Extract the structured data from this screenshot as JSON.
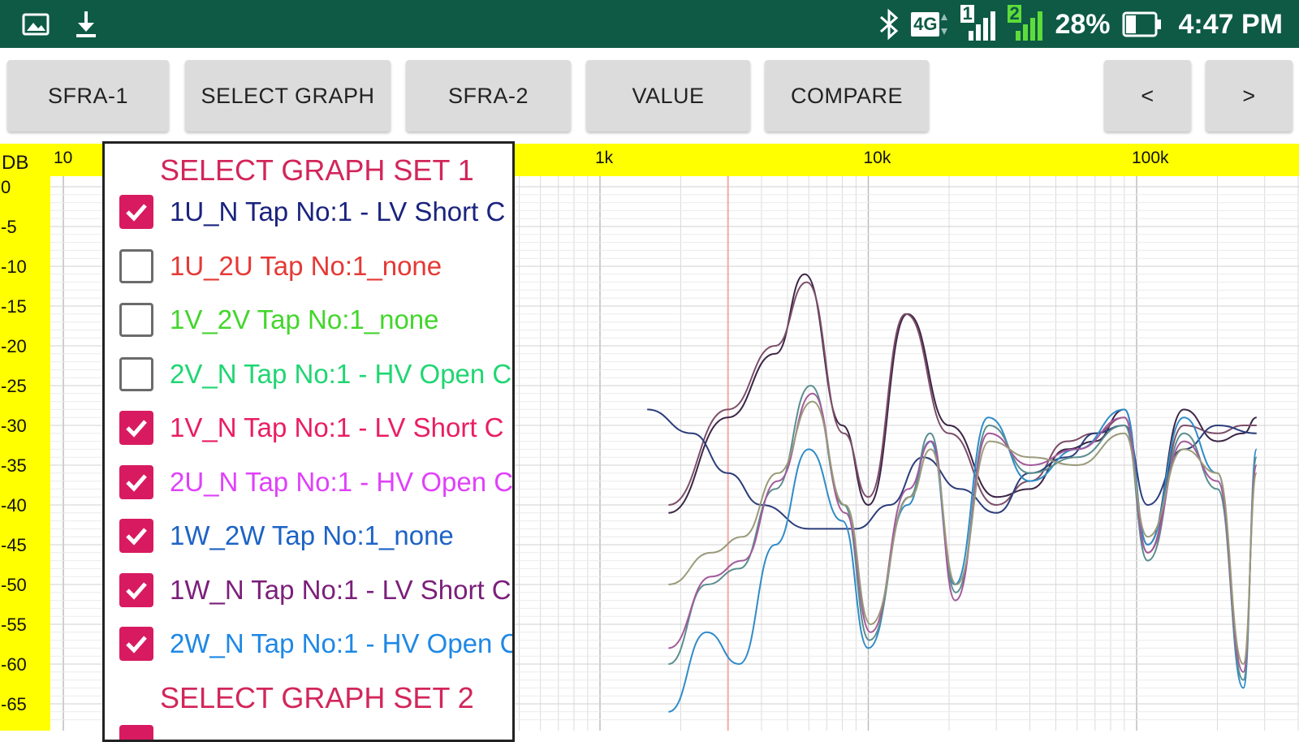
{
  "status_bar": {
    "network": "4G",
    "sim1": "1",
    "sim2": "2",
    "battery": "28%",
    "time": "4:47 PM",
    "icons": [
      "image-icon",
      "download-icon",
      "bluetooth-icon",
      "network-4g-icon",
      "signal-sim1-icon",
      "signal-sim2-icon",
      "battery-icon"
    ]
  },
  "toolbar": {
    "buttons": [
      {
        "label": "SFRA-1"
      },
      {
        "label": "SELECT GRAPH"
      },
      {
        "label": "SFRA-2"
      },
      {
        "label": "VALUE"
      },
      {
        "label": "COMPARE"
      },
      {
        "label": "<"
      },
      {
        "label": ">"
      }
    ]
  },
  "chart_data": {
    "type": "line",
    "title": "",
    "xlabel": "",
    "ylabel": "DB",
    "x_scale": "log",
    "x_ticks": [
      "10",
      "1k",
      "10k",
      "100k"
    ],
    "y_ticks": [
      "0",
      "-5",
      "-10",
      "-15",
      "-20",
      "-25",
      "-30",
      "-35",
      "-40",
      "-45",
      "-50",
      "-55",
      "-60",
      "-65"
    ],
    "ylim": [
      -67,
      2
    ],
    "grid": true,
    "axis_band_color": "#ffff00",
    "marker_x": 3000,
    "series": [
      {
        "color": "#3b2545",
        "points": [
          [
            1800,
            -41
          ],
          [
            3000,
            -29
          ],
          [
            4500,
            -21
          ],
          [
            5800,
            -11
          ],
          [
            8000,
            -30
          ],
          [
            10000,
            -40
          ],
          [
            14000,
            -16
          ],
          [
            20000,
            -30
          ],
          [
            30000,
            -39
          ],
          [
            40000,
            -38
          ],
          [
            55000,
            -33
          ],
          [
            70000,
            -32
          ],
          [
            90000,
            -28
          ],
          [
            110000,
            -45
          ],
          [
            150000,
            -28
          ],
          [
            200000,
            -32
          ],
          [
            250000,
            -31
          ],
          [
            280000,
            -29
          ]
        ]
      },
      {
        "color": "#7d4e68",
        "points": [
          [
            1800,
            -40
          ],
          [
            3000,
            -28
          ],
          [
            4500,
            -20
          ],
          [
            5900,
            -12
          ],
          [
            8100,
            -31
          ],
          [
            10000,
            -39
          ],
          [
            13800,
            -16
          ],
          [
            20000,
            -31
          ],
          [
            30000,
            -40
          ],
          [
            40000,
            -37
          ],
          [
            55000,
            -32
          ],
          [
            70000,
            -31
          ],
          [
            90000,
            -29
          ],
          [
            110000,
            -46
          ],
          [
            150000,
            -30
          ],
          [
            200000,
            -31
          ],
          [
            250000,
            -30
          ],
          [
            280000,
            -30
          ]
        ]
      },
      {
        "color": "#2b3d7a",
        "points": [
          [
            1500,
            -28
          ],
          [
            2200,
            -31
          ],
          [
            3000,
            -36
          ],
          [
            4000,
            -40
          ],
          [
            6000,
            -43
          ],
          [
            9000,
            -43
          ],
          [
            12000,
            -40
          ],
          [
            16000,
            -34
          ],
          [
            22000,
            -38
          ],
          [
            30000,
            -41
          ],
          [
            40000,
            -36
          ],
          [
            55000,
            -34
          ],
          [
            70000,
            -31
          ],
          [
            90000,
            -30
          ],
          [
            110000,
            -40
          ],
          [
            150000,
            -33
          ],
          [
            200000,
            -30
          ],
          [
            280000,
            -31
          ]
        ]
      },
      {
        "color": "#2f8cc8",
        "points": [
          [
            1800,
            -66
          ],
          [
            2500,
            -56
          ],
          [
            3300,
            -60
          ],
          [
            4500,
            -45
          ],
          [
            6000,
            -33
          ],
          [
            8000,
            -42
          ],
          [
            10000,
            -58
          ],
          [
            14000,
            -40
          ],
          [
            17000,
            -32
          ],
          [
            21000,
            -50
          ],
          [
            28000,
            -29
          ],
          [
            40000,
            -37
          ],
          [
            60000,
            -33
          ],
          [
            90000,
            -28
          ],
          [
            110000,
            -45
          ],
          [
            150000,
            -29
          ],
          [
            200000,
            -36
          ],
          [
            250000,
            -63
          ],
          [
            280000,
            -33
          ]
        ]
      },
      {
        "color": "#5a8e8f",
        "points": [
          [
            1800,
            -60
          ],
          [
            2500,
            -50
          ],
          [
            3300,
            -48
          ],
          [
            4500,
            -38
          ],
          [
            6100,
            -25
          ],
          [
            8100,
            -40
          ],
          [
            10100,
            -57
          ],
          [
            14200,
            -39
          ],
          [
            17000,
            -31
          ],
          [
            21200,
            -51
          ],
          [
            28200,
            -30
          ],
          [
            40000,
            -36
          ],
          [
            60000,
            -34
          ],
          [
            90000,
            -30
          ],
          [
            110000,
            -47
          ],
          [
            150000,
            -31
          ],
          [
            200000,
            -38
          ],
          [
            250000,
            -62
          ],
          [
            280000,
            -34
          ]
        ]
      },
      {
        "color": "#a35a9c",
        "points": [
          [
            1800,
            -58
          ],
          [
            2600,
            -49
          ],
          [
            3400,
            -47
          ],
          [
            4600,
            -37
          ],
          [
            6200,
            -26
          ],
          [
            8200,
            -41
          ],
          [
            10200,
            -56
          ],
          [
            14100,
            -38
          ],
          [
            17200,
            -32
          ],
          [
            21100,
            -52
          ],
          [
            28100,
            -31
          ],
          [
            40000,
            -35
          ],
          [
            60000,
            -33
          ],
          [
            90000,
            -29
          ],
          [
            110000,
            -46
          ],
          [
            150000,
            -32
          ],
          [
            200000,
            -37
          ],
          [
            250000,
            -61
          ],
          [
            280000,
            -35
          ]
        ]
      },
      {
        "color": "#9a9a7a",
        "points": [
          [
            1800,
            -50
          ],
          [
            2600,
            -46
          ],
          [
            3400,
            -44
          ],
          [
            4600,
            -36
          ],
          [
            6200,
            -27
          ],
          [
            8200,
            -40
          ],
          [
            10200,
            -55
          ],
          [
            14300,
            -39
          ],
          [
            17100,
            -33
          ],
          [
            21300,
            -50
          ],
          [
            28300,
            -32
          ],
          [
            40000,
            -34
          ],
          [
            60000,
            -35
          ],
          [
            90000,
            -31
          ],
          [
            110000,
            -44
          ],
          [
            150000,
            -33
          ],
          [
            200000,
            -36
          ],
          [
            250000,
            -60
          ],
          [
            280000,
            -36
          ]
        ]
      }
    ]
  },
  "graph_selector": {
    "set1_title": "SELECT GRAPH SET 1",
    "set2_title": "SELECT GRAPH SET 2",
    "items": [
      {
        "label": "1U_N Tap No:1 - LV Short C",
        "checked": true,
        "color": "#1a237e"
      },
      {
        "label": "1U_2U Tap No:1_none",
        "checked": false,
        "color": "#e53935"
      },
      {
        "label": "1V_2V Tap No:1_none",
        "checked": false,
        "color": "#43d62c"
      },
      {
        "label": "2V_N Tap No:1 - HV Open C",
        "checked": false,
        "color": "#1fd672"
      },
      {
        "label": "1V_N Tap No:1 - LV Short C",
        "checked": true,
        "color": "#e91e63"
      },
      {
        "label": "2U_N Tap No:1 - HV Open C",
        "checked": true,
        "color": "#e040fb"
      },
      {
        "label": "1W_2W Tap No:1_none",
        "checked": true,
        "color": "#1e63c6"
      },
      {
        "label": "1W_N Tap No:1 - LV Short C",
        "checked": true,
        "color": "#7b1f7a"
      },
      {
        "label": "2W_N Tap No:1 - HV Open C",
        "checked": true,
        "color": "#1e88e5"
      }
    ]
  }
}
